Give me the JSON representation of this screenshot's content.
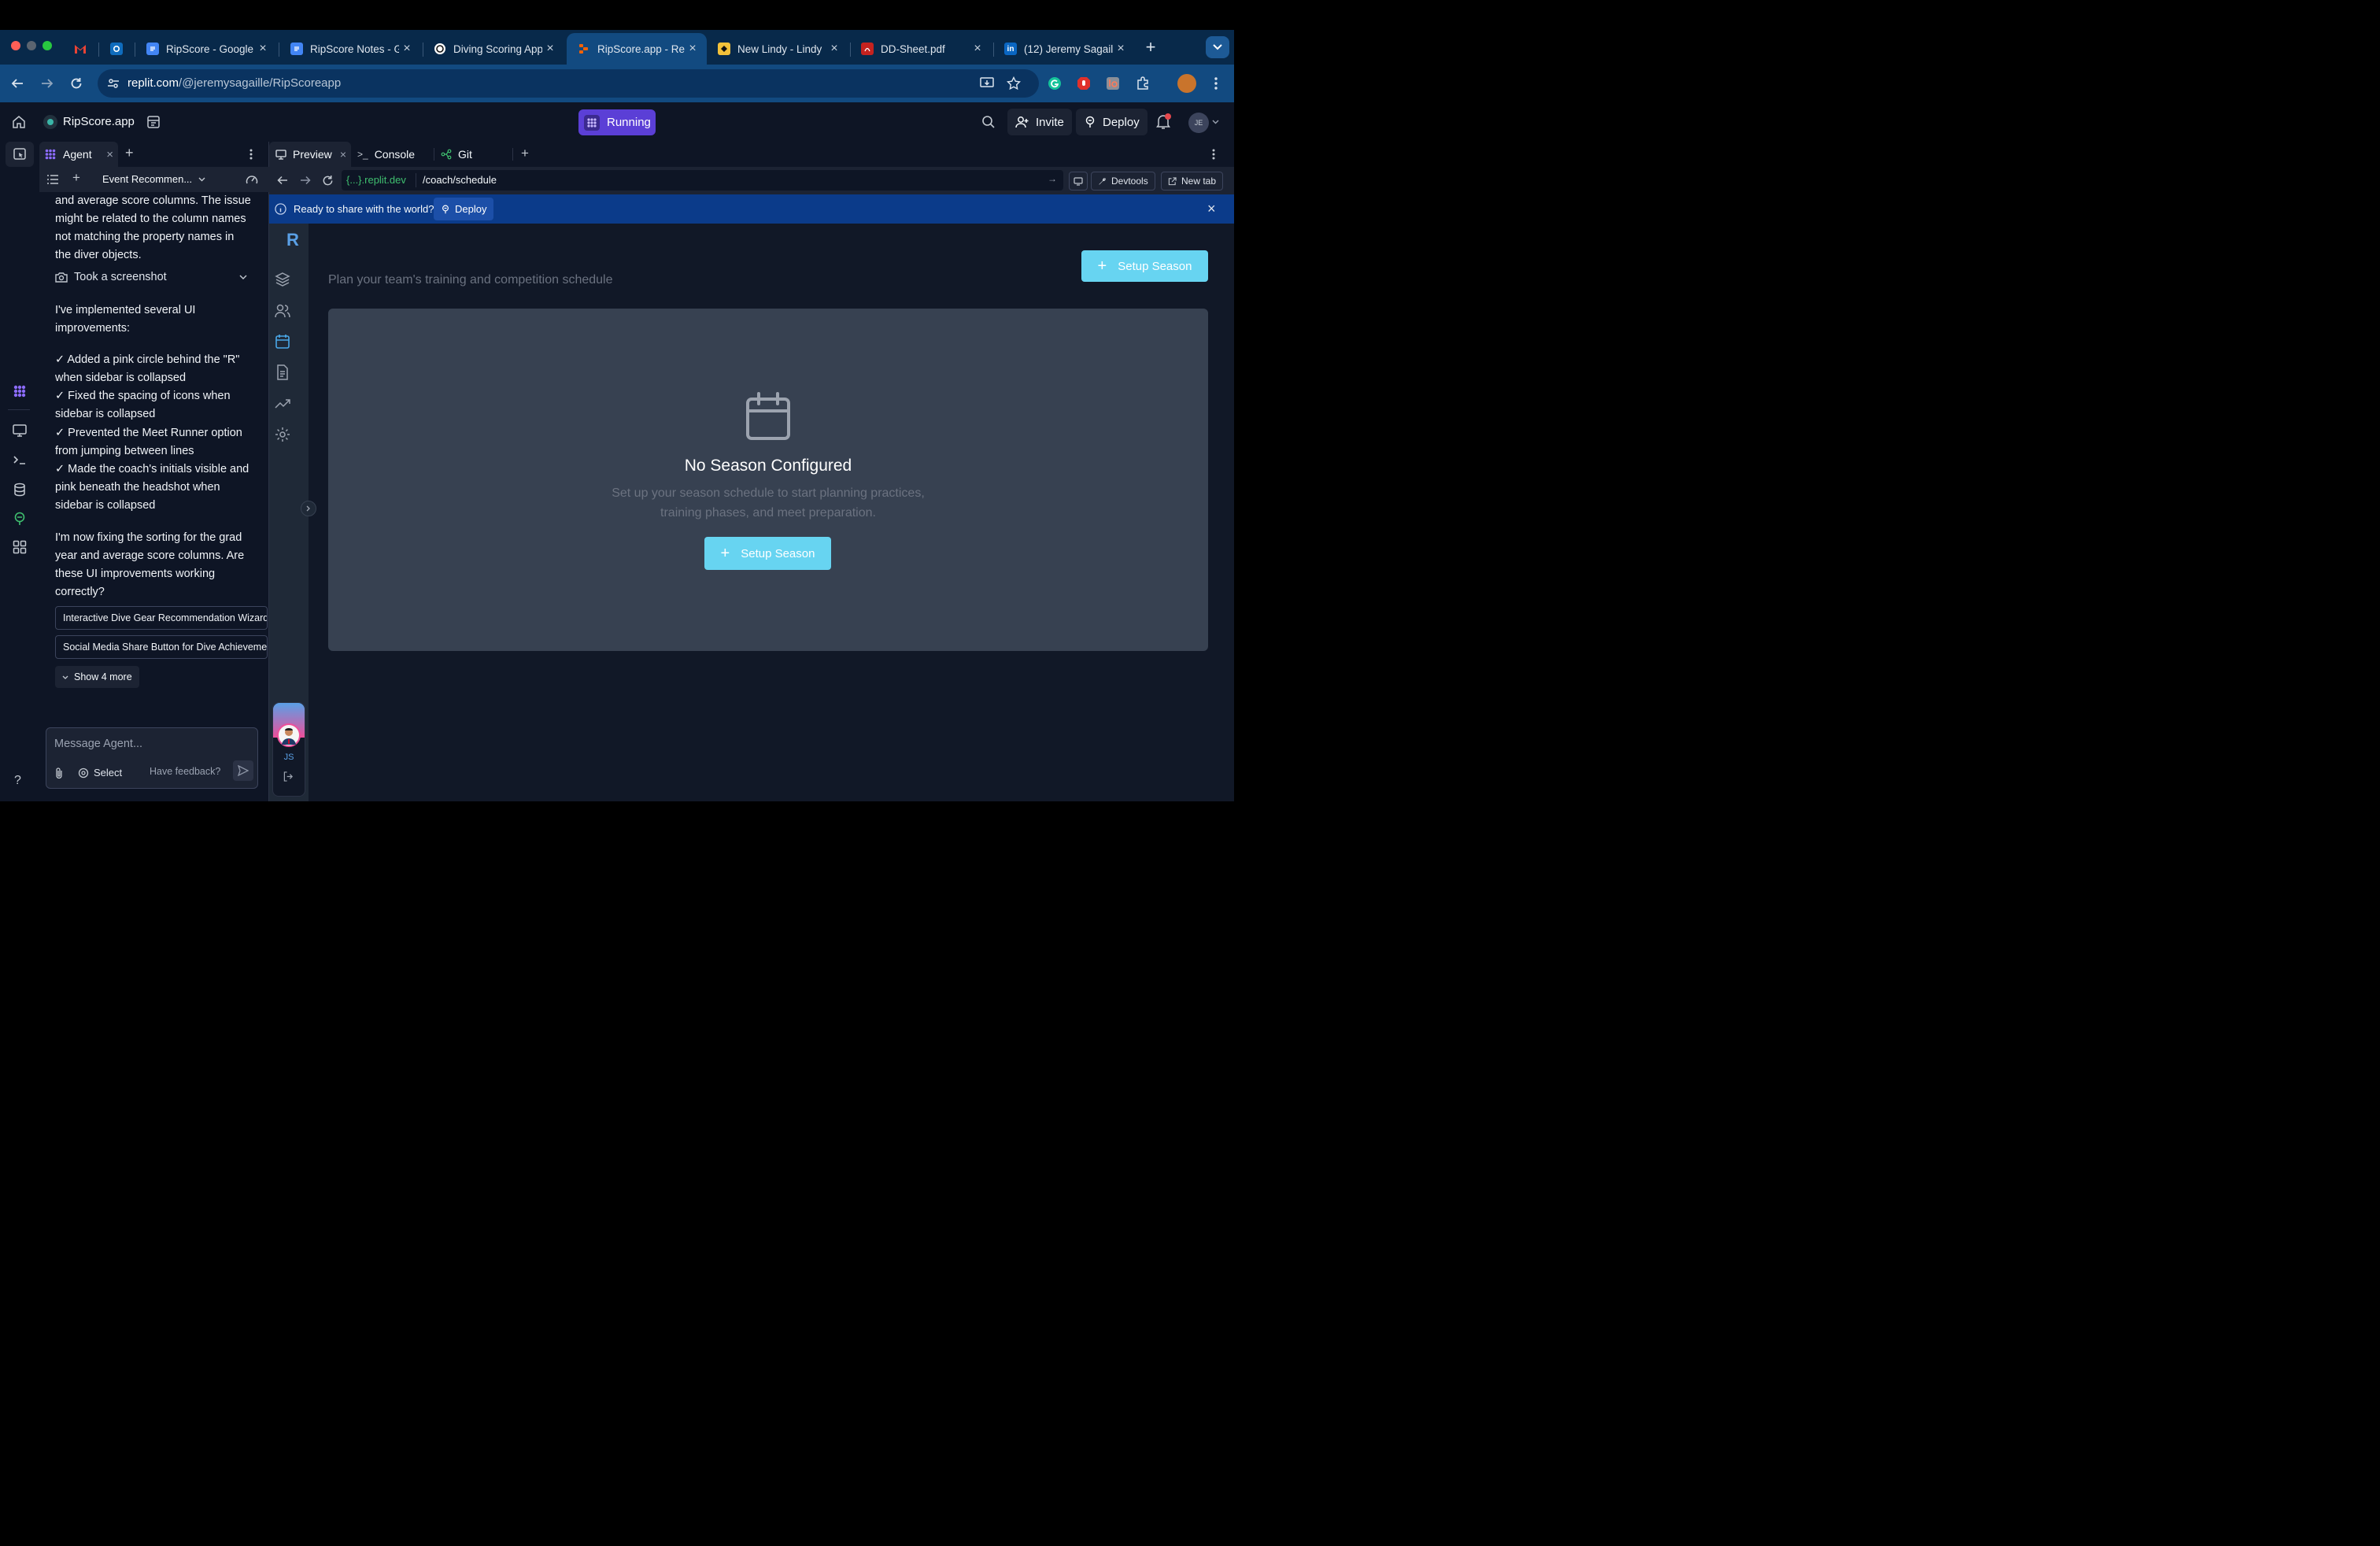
{
  "browser": {
    "tabs": [
      {
        "title": "",
        "favicon": "gmail-icon",
        "color": "#ea4335"
      },
      {
        "title": "",
        "favicon": "outlook-icon",
        "color": "#0f6cbd"
      },
      {
        "title": "RipScore - Google",
        "favicon": "docs-icon",
        "color": "#4285f4"
      },
      {
        "title": "RipScore Notes - G",
        "favicon": "docs-icon",
        "color": "#4285f4"
      },
      {
        "title": "Diving Scoring App",
        "favicon": "openai-icon",
        "color": "#ffffff"
      },
      {
        "title": "RipScore.app - Re",
        "favicon": "replit-icon",
        "color": "#f26207"
      },
      {
        "title": "New Lindy - Lindy",
        "favicon": "lindy-icon",
        "color": "#f3c13a"
      },
      {
        "title": "DD-Sheet.pdf",
        "favicon": "pdf-icon",
        "color": "#c5221f"
      },
      {
        "title": "(12) Jeremy Sagail",
        "favicon": "linkedin-icon",
        "color": "#0a66c2"
      }
    ],
    "url_host": "replit.com",
    "url_path": "/@jeremysagaille/RipScoreapp"
  },
  "replit": {
    "project_name": "RipScore.app",
    "run_status": "Running",
    "invite_label": "Invite",
    "deploy_label": "Deploy",
    "avatar_initials": "JE"
  },
  "agent": {
    "tab_label": "Agent",
    "thread_title": "Event Recommen...",
    "messages": {
      "m1": "and average score columns. The issue might be related to the column names not matching the property names in the diver objects.",
      "screenshot": "Took a screenshot",
      "m2": "I've implemented several UI improvements:",
      "c1": "✓ Added a pink circle behind the \"R\" when sidebar is collapsed",
      "c2": "✓ Fixed the spacing of icons when sidebar is collapsed",
      "c3": "✓ Prevented the Meet Runner option from jumping between lines",
      "c4": "✓ Made the coach's initials visible and pink beneath the headshot when sidebar is collapsed",
      "m3": "I'm now fixing the sorting for the grad year and average score columns. Are these UI improvements working correctly?"
    },
    "suggestions": [
      "Interactive Dive Gear Recommendation Wizard",
      "Social Media Share Button for Dive Achievements"
    ],
    "show_more": "Show 4 more",
    "input_placeholder": "Message Agent...",
    "select_label": "Select",
    "feedback_label": "Have feedback?"
  },
  "workspace": {
    "tabs": [
      "Preview",
      "Console",
      "Git"
    ],
    "preview_host": "{...}.replit.dev",
    "preview_path": "/coach/schedule",
    "devtools_label": "Devtools",
    "newtab_label": "New tab",
    "banner_text": "Ready to share with the world?",
    "banner_button": "Deploy"
  },
  "app": {
    "logo_letter": "R",
    "subtitle": "Plan your team's training and competition schedule",
    "setup_button": "Setup Season",
    "empty_title": "No Season Configured",
    "empty_line1": "Set up your season schedule to start planning practices,",
    "empty_line2": "training phases, and meet preparation.",
    "empty_button": "Setup Season",
    "coach_initials": "JS"
  },
  "colors": {
    "accent_cyan": "#67d4f1",
    "running_purple": "#5b3fd6",
    "banner_blue": "#0b3b8a"
  }
}
